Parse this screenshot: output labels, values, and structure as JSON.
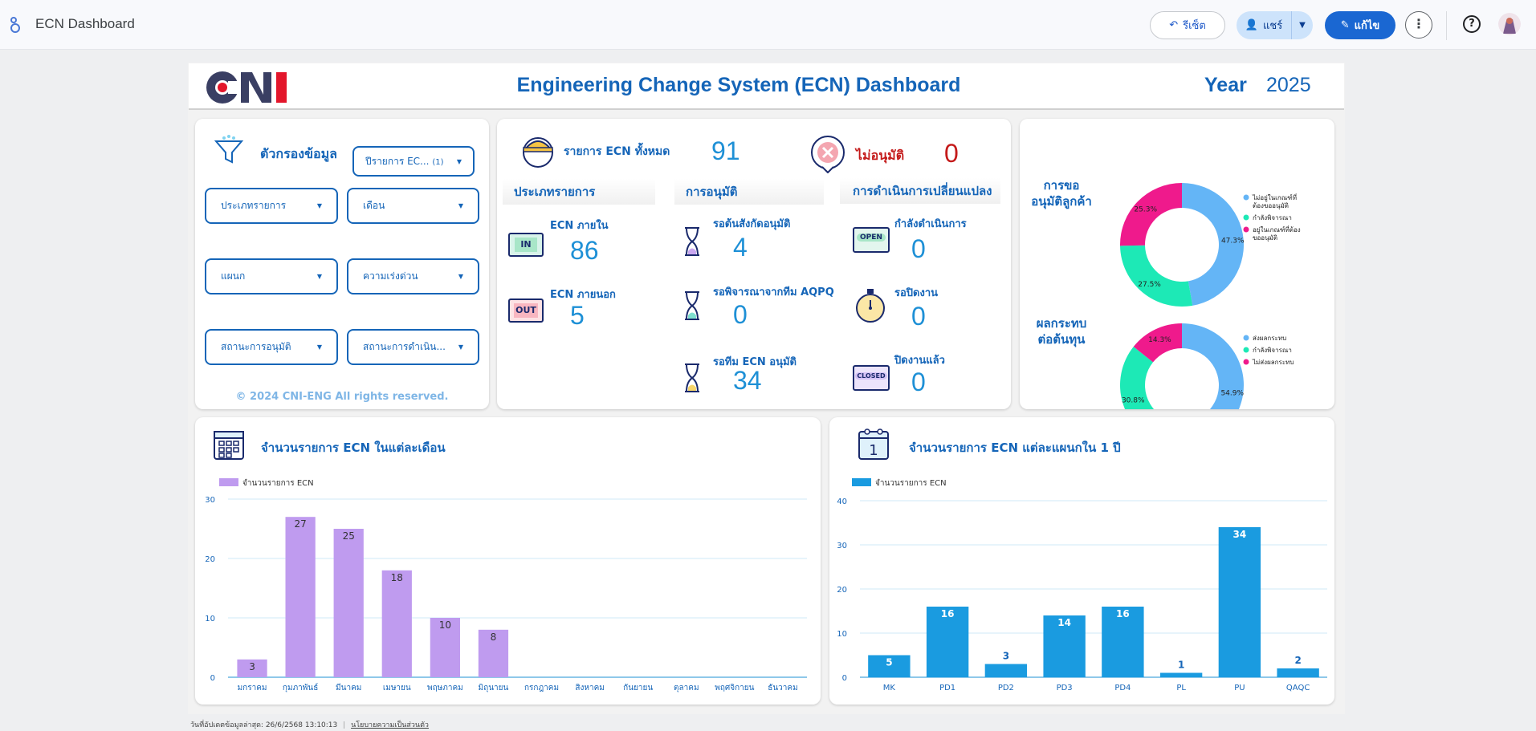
{
  "app": {
    "title": "ECN Dashboard"
  },
  "toolbar": {
    "reset_label": "รีเซ็ต",
    "share_label": "แชร์",
    "edit_label": "แก้ไข"
  },
  "header": {
    "title": "Engineering Change System (ECN) Dashboard",
    "year_label": "Year",
    "year_value": "2025"
  },
  "filters": {
    "title": "ตัวกรองข้อมูล",
    "year_dropdown": "ปีรายการ EC...",
    "year_count": "(1)",
    "dropdowns": [
      "ประเภทรายการ",
      "เดือน",
      "แผนก",
      "ความเร่งด่วน",
      "สถานะการอนุมัติ",
      "สถานะการดำเนิน..."
    ],
    "copyright": "© 2024 CNI-ENG All rights reserved."
  },
  "summary": {
    "total_label": "รายการ ECN ทั้งหมด",
    "total_value": "91",
    "reject_label": "ไม่อนุมัติ",
    "reject_value": "0",
    "section_type": "ประเภทรายการ",
    "section_approval": "การอนุมัติ",
    "section_progress": "การดำเนินการเปลี่ยนแปลง",
    "internal_label": "ECN ภายใน",
    "internal_value": "86",
    "internal_badge": "IN",
    "external_label": "ECN ภายนอก",
    "external_value": "5",
    "external_badge": "OUT",
    "wait_head_label": "รอต้นสังกัดอนุมัติ",
    "wait_head_value": "4",
    "wait_aqpq_label": "รอพิจารณาจากทีม AQPQ",
    "wait_aqpq_value": "0",
    "wait_ecn_label": "รอทีม ECN อนุมัติ",
    "wait_ecn_value": "34",
    "in_progress_label": "กำลังดำเนินการ",
    "in_progress_value": "0",
    "open_badge": "OPEN",
    "wait_close_label": "รอปิดงาน",
    "wait_close_value": "0",
    "closed_label": "ปิดงานแล้ว",
    "closed_value": "0",
    "closed_badge": "CLOSED"
  },
  "donuts": [
    {
      "title_lines": [
        "การขอ",
        "อนุมัติลูกค้า"
      ],
      "slices": [
        {
          "name": "ไม่อยู่ในเกณฑ์ที่ต้องขออนุมัติ",
          "value": 47.3,
          "label": "47.3%",
          "color": "#64b5f6"
        },
        {
          "name": "กำลังพิจารณา",
          "value": 27.5,
          "label": "27.5%",
          "color": "#1de9b6"
        },
        {
          "name": "อยู่ในเกณฑ์ที่ต้องขออนุมัติ",
          "value": 25.3,
          "label": "25.3%",
          "color": "#ef1a8c"
        }
      ],
      "legend": [
        [
          "ไม่อยู่ในเกณฑ์ที่",
          "ต้องขออนุมัติ"
        ],
        [
          "กำลังพิจารณา"
        ],
        [
          "อยู่ในเกณฑ์ที่ต้อง",
          "ขออนุมัติ"
        ]
      ]
    },
    {
      "title_lines": [
        "ผลกระทบ",
        "ต่อต้นทุน"
      ],
      "slices": [
        {
          "name": "ส่งผลกระทบ",
          "value": 54.9,
          "label": "54.9%",
          "color": "#64b5f6"
        },
        {
          "name": "กำลังพิจารณา",
          "value": 30.8,
          "label": "30.8%",
          "color": "#1de9b6"
        },
        {
          "name": "ไม่ส่งผลกระทบ",
          "value": 14.3,
          "label": "14.3%",
          "color": "#ef1a8c"
        }
      ],
      "legend": [
        [
          "ส่งผลกระทบ"
        ],
        [
          "กำลังพิจารณา"
        ],
        [
          "ไม่ส่งผลกระทบ"
        ]
      ]
    }
  ],
  "monthly": {
    "title": "จำนวนรายการ ECN ในแต่ละเดือน",
    "calendar_icon_text": ""
  },
  "dept": {
    "title": "จำนวนรายการ ECN แต่ละแผนกใน 1 ปี",
    "calendar_day": "1"
  },
  "chart_data": [
    {
      "type": "bar",
      "title": "จำนวนรายการ ECN ในแต่ละเดือน",
      "legend": "จำนวนรายการ ECN",
      "categories": [
        "มกราคม",
        "กุมภาพันธ์",
        "มีนาคม",
        "เมษายน",
        "พฤษภาคม",
        "มิถุนายน",
        "กรกฎาคม",
        "สิงหาคม",
        "กันยายน",
        "ตุลาคม",
        "พฤศจิกายน",
        "ธันวาคม"
      ],
      "values": [
        3,
        27,
        25,
        18,
        10,
        8,
        null,
        null,
        null,
        null,
        null,
        null
      ],
      "ylim": [
        0,
        30
      ],
      "yticks": [
        0,
        10,
        20,
        30
      ],
      "color": "#bf9bef",
      "grid": true
    },
    {
      "type": "bar",
      "title": "จำนวนรายการ ECN แต่ละแผนกใน 1 ปี",
      "legend": "จำนวนรายการ ECN",
      "categories": [
        "MK",
        "PD1",
        "PD2",
        "PD3",
        "PD4",
        "PL",
        "PU",
        "QAQC"
      ],
      "values": [
        5,
        16,
        3,
        14,
        16,
        1,
        34,
        2
      ],
      "ylim": [
        0,
        40
      ],
      "yticks": [
        0,
        10,
        20,
        30,
        40
      ],
      "color": "#1a9be0",
      "grid": true
    }
  ],
  "footer": {
    "updated": "วันที่อัปเดตข้อมูลล่าสุด: 26/6/2568 13:10:13",
    "privacy": "นโยบายความเป็นส่วนตัว"
  }
}
